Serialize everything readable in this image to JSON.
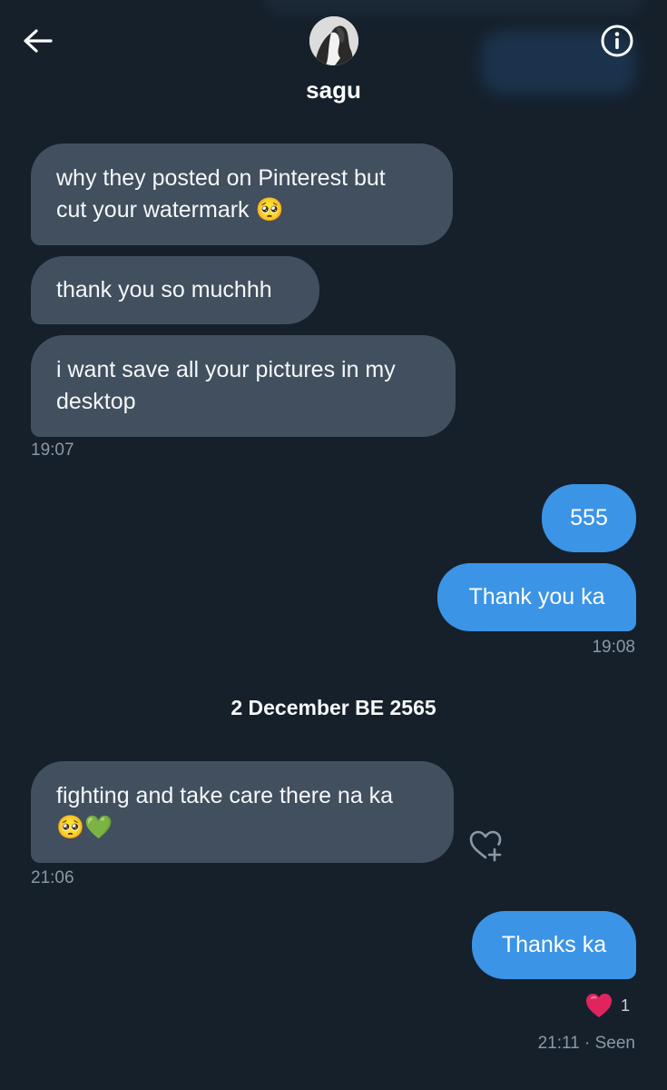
{
  "header": {
    "name": "sagu",
    "back_icon": "arrow-left-icon",
    "info_icon": "info-circle-icon"
  },
  "messages": [
    {
      "text": "why they posted on Pinterest but\ncut your watermark 🥺"
    },
    {
      "text": "thank you so muchhh"
    },
    {
      "text": "i want save all your pictures in my\ndesktop"
    },
    {
      "text": "555"
    },
    {
      "text": "Thank you ka"
    },
    {
      "text": "fighting and take care there na ka\n🥺💚"
    },
    {
      "text": "Thanks ka"
    }
  ],
  "timestamps": {
    "t1": "19:07",
    "t2": "19:08",
    "t3": "21:06",
    "t4": "21:11 · Seen"
  },
  "date_separator": "2 December BE 2565",
  "reaction": {
    "icon": "heart-icon",
    "count": "1"
  },
  "colors": {
    "background": "#15202b",
    "incoming_bubble": "#414f5e",
    "outgoing_bubble": "#3b94e6",
    "timestamp": "#8b98a5"
  }
}
